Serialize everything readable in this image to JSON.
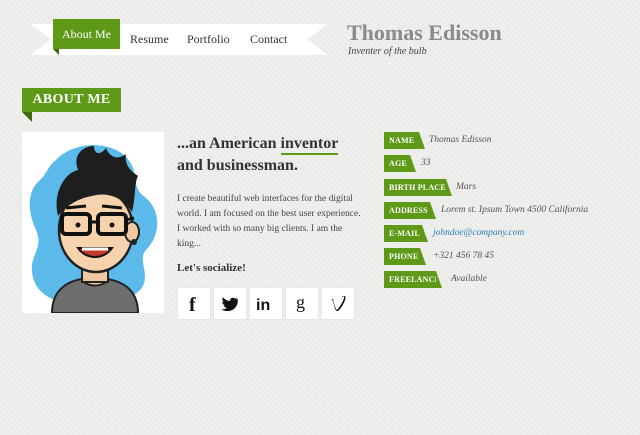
{
  "nav": {
    "items": [
      "About Me",
      "Resume",
      "Portfolio",
      "Contact"
    ],
    "active": "About Me"
  },
  "site": {
    "name": "Thomas Edisson",
    "tagline": "Inventer of the bulb"
  },
  "section": {
    "heading": "ABOUT ME"
  },
  "intro": {
    "headline_prefix": "...an American ",
    "headline_highlight": "inventor",
    "headline_suffix": "and businessman.",
    "bio": "I create beautiful web interfaces for the digital world. I am focused on the best user experience. I worked with so many big clients. I am the king...",
    "social_label": "Let's socialize!"
  },
  "social": [
    {
      "icon": "facebook-icon",
      "glyph": "f"
    },
    {
      "icon": "twitter-icon",
      "glyph": "bird"
    },
    {
      "icon": "linkedin-icon",
      "glyph": "in"
    },
    {
      "icon": "google-icon",
      "glyph": "g"
    },
    {
      "icon": "vimeo-icon",
      "glyph": "v"
    }
  ],
  "info": [
    {
      "label": "NAME",
      "value": "Thomas Edisson"
    },
    {
      "label": "AGE",
      "value": "33"
    },
    {
      "label": "BIRTH PLACE",
      "value": "Mars"
    },
    {
      "label": "ADDRESS",
      "value": "Lorem st. Ipsum Town 4500 California"
    },
    {
      "label": "E-MAIL",
      "value": "johndoe@company.com"
    },
    {
      "label": "PHONE",
      "value": "+321 456 78 45"
    },
    {
      "label": "FREELANCE",
      "value": "Available"
    }
  ],
  "colors": {
    "accent": "#5e9a18",
    "accent_dark": "#3c6a0c",
    "link": "#2f7fb3",
    "avatar_blob": "#5bbaea"
  }
}
